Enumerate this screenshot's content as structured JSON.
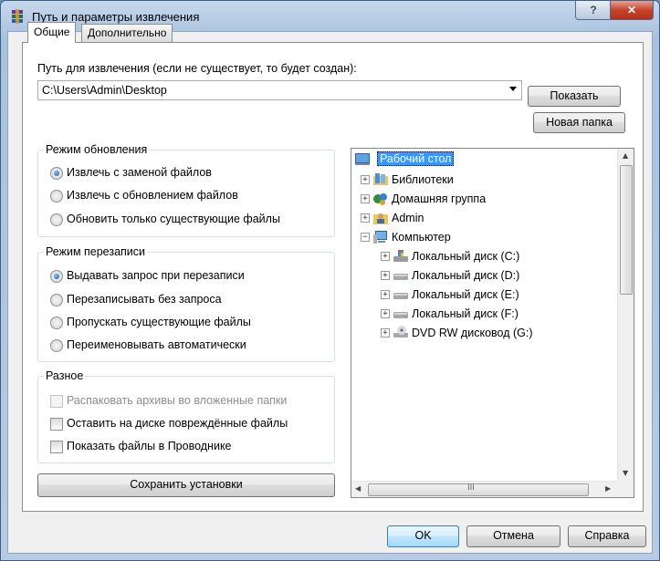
{
  "window": {
    "title": "Путь и параметры извлечения",
    "help_label": "?",
    "close_label": "✕"
  },
  "tabs": [
    {
      "label": "Общие"
    },
    {
      "label": "Дополнительно"
    }
  ],
  "path": {
    "label": "Путь для извлечения (если не существует, то будет создан):",
    "value": "C:\\Users\\Admin\\Desktop"
  },
  "buttons": {
    "show": "Показать",
    "new_folder": "Новая папка",
    "save_settings": "Сохранить установки",
    "ok": "OK",
    "cancel": "Отмена",
    "help": "Справка"
  },
  "update_mode": {
    "title": "Режим обновления",
    "options": [
      {
        "label": "Извлечь с заменой файлов",
        "selected": true
      },
      {
        "label": "Извлечь с обновлением файлов",
        "selected": false
      },
      {
        "label": "Обновить только существующие файлы",
        "selected": false
      }
    ]
  },
  "overwrite_mode": {
    "title": "Режим перезаписи",
    "options": [
      {
        "label": "Выдавать запрос при перезаписи",
        "selected": true
      },
      {
        "label": "Перезаписывать без запроса",
        "selected": false
      },
      {
        "label": "Пропускать существующие файлы",
        "selected": false
      },
      {
        "label": "Переименовывать автоматически",
        "selected": false
      }
    ]
  },
  "misc": {
    "title": "Разное",
    "options": [
      {
        "label": "Распаковать архивы во вложенные папки",
        "checked": false,
        "disabled": true
      },
      {
        "label": "Оставить на диске повреждённые файлы",
        "checked": false,
        "disabled": false
      },
      {
        "label": "Показать файлы в Проводнике",
        "checked": false,
        "disabled": false
      }
    ]
  },
  "tree": {
    "root": "Рабочий стол",
    "items": [
      {
        "label": "Библиотеки",
        "icon": "libraries-icon"
      },
      {
        "label": "Домашняя группа",
        "icon": "homegroup-icon"
      },
      {
        "label": "Admin",
        "icon": "user-folder-icon"
      },
      {
        "label": "Компьютер",
        "icon": "computer-icon"
      },
      {
        "label": "Локальный диск (C:)",
        "icon": "system-drive-icon"
      },
      {
        "label": "Локальный диск (D:)",
        "icon": "drive-icon"
      },
      {
        "label": "Локальный диск (E:)",
        "icon": "drive-icon"
      },
      {
        "label": "Локальный диск (F:)",
        "icon": "drive-icon"
      },
      {
        "label": "DVD RW дисковод (G:)",
        "icon": "dvd-drive-icon"
      }
    ],
    "hscroll_glyph": "III"
  },
  "colors": {
    "accent": "#3399ff",
    "title_bar": "#b7cbe3",
    "close": "#c7432b"
  }
}
